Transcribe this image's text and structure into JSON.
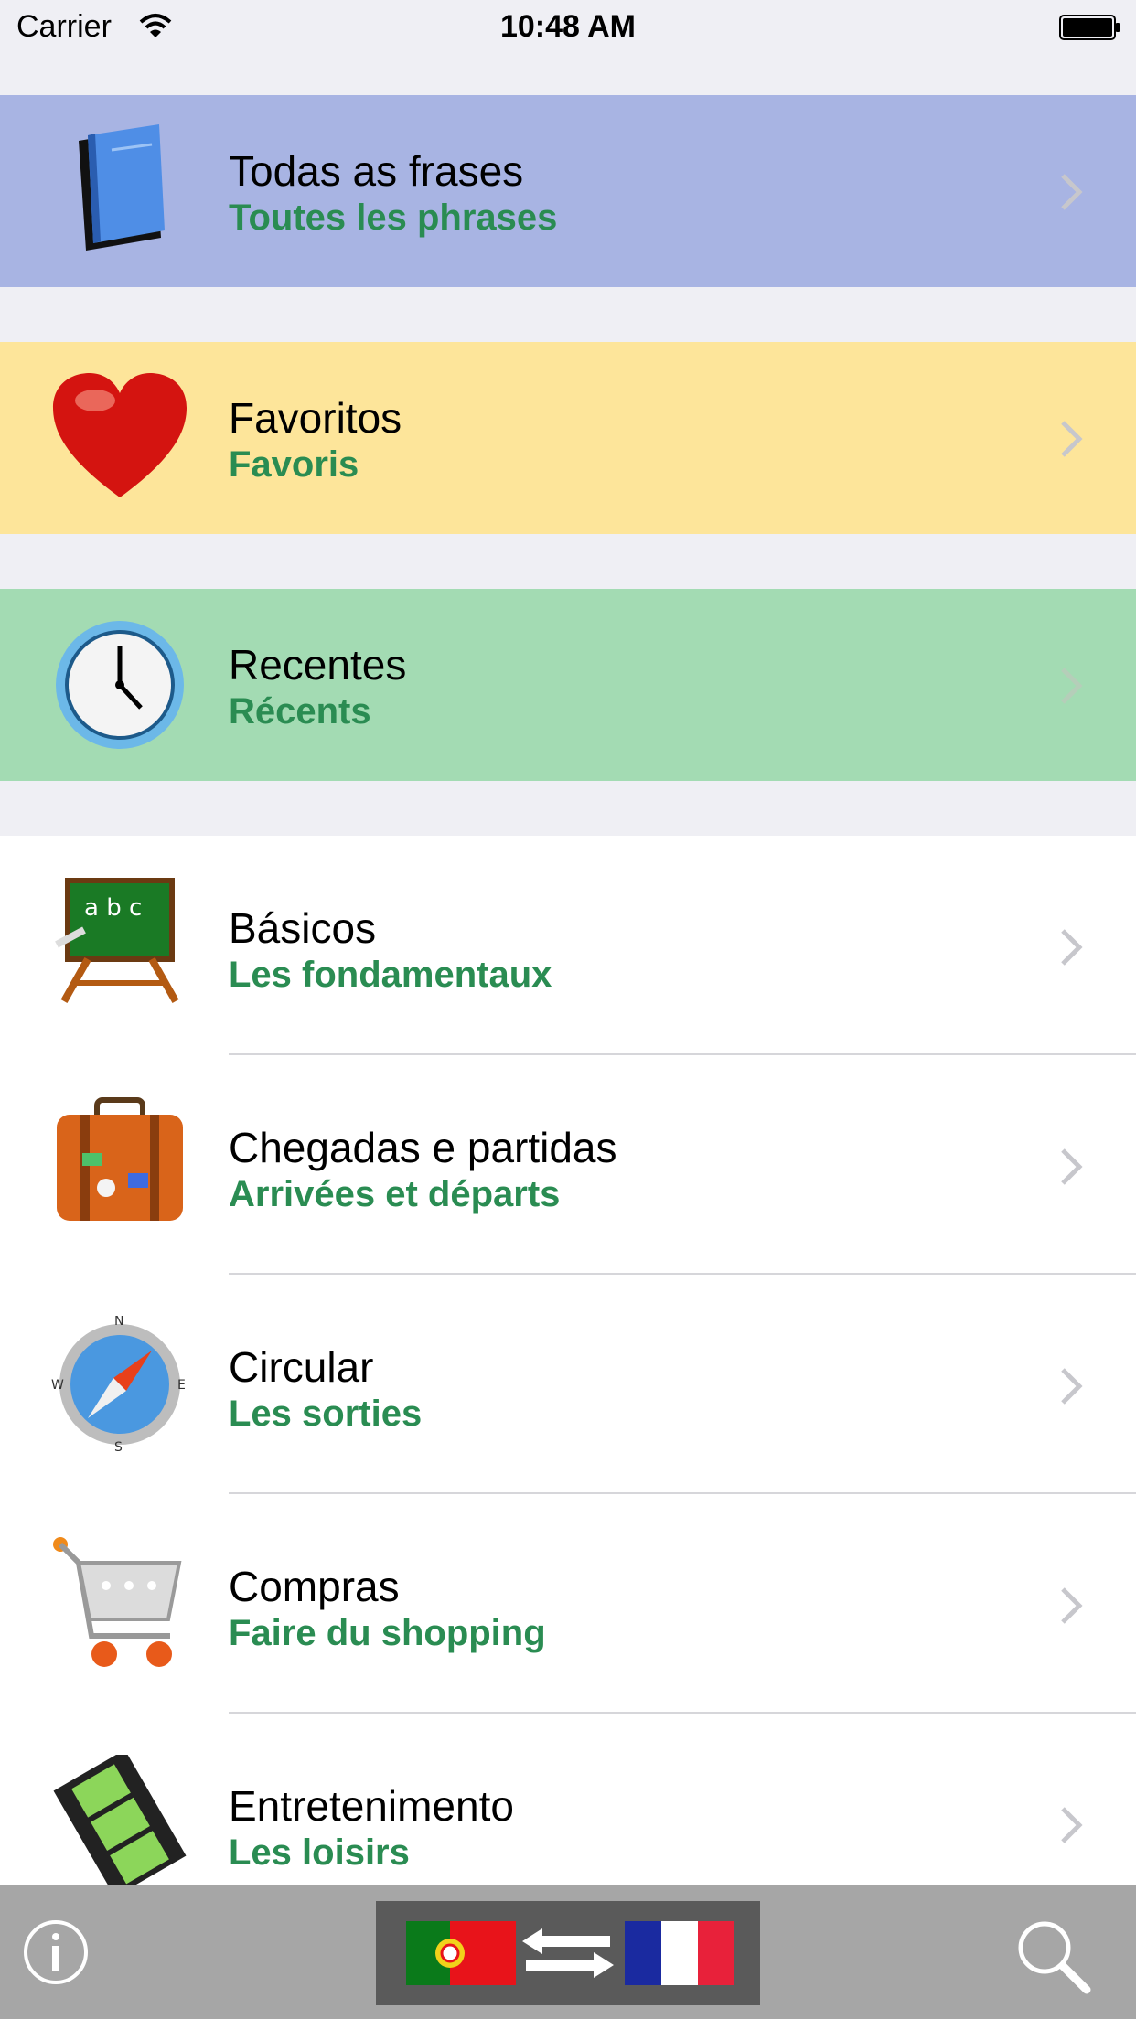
{
  "status_bar": {
    "carrier": "Carrier",
    "time": "10:48 AM"
  },
  "colors": {
    "row_all_bg": "#a8b4e3",
    "row_favorites_bg": "#fde59a",
    "row_recent_bg": "#a3dbb3",
    "subtitle_green": "#2a8c52",
    "toolbar_bg": "#a6a6a6"
  },
  "menu": {
    "all": {
      "title": "Todas as frases",
      "subtitle": "Toutes les phrases",
      "icon": "book-icon"
    },
    "favorites": {
      "title": "Favoritos",
      "subtitle": "Favoris",
      "icon": "heart-icon"
    },
    "recent": {
      "title": "Recentes",
      "subtitle": "Récents",
      "icon": "clock-icon"
    }
  },
  "categories": [
    {
      "title": "Básicos",
      "subtitle": "Les fondamentaux",
      "icon": "chalkboard-icon"
    },
    {
      "title": "Chegadas e partidas",
      "subtitle": "Arrivées et départs",
      "icon": "suitcase-icon"
    },
    {
      "title": "Circular",
      "subtitle": "Les sorties",
      "icon": "compass-icon"
    },
    {
      "title": "Compras",
      "subtitle": "Faire du shopping",
      "icon": "shopping-cart-icon"
    },
    {
      "title": "Entretenimento",
      "subtitle": "Les loisirs",
      "icon": "film-icon"
    }
  ],
  "toolbar": {
    "info_icon": "info-icon",
    "search_icon": "search-icon",
    "source_flag": "portugal-flag-icon",
    "target_flag": "france-flag-icon",
    "swap_icon": "swap-arrows-icon"
  }
}
